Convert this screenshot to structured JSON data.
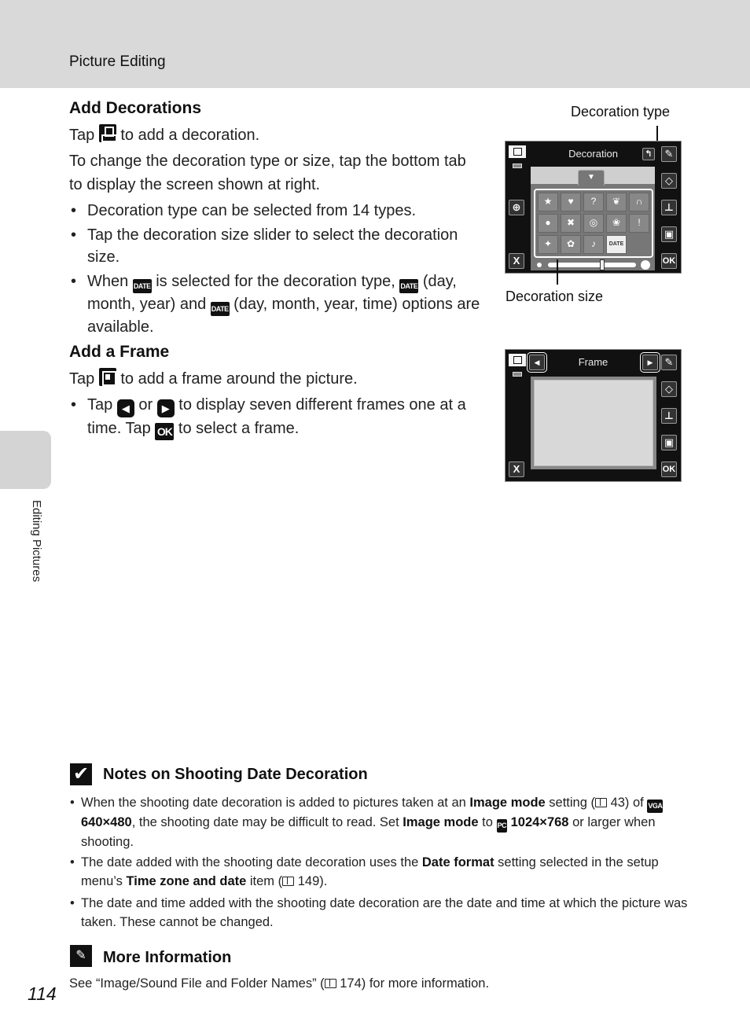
{
  "header": {
    "title": "Picture Editing"
  },
  "side_tab": {
    "label": "Editing Pictures"
  },
  "page_number": "114",
  "sections": {
    "decorations": {
      "heading": "Add Decorations",
      "tap_pre": "Tap",
      "tap_post": "to add a decoration.",
      "intro": "To change the decoration type or size, tap the bottom tab to display the screen shown at right.",
      "bullet1": "Decoration type can be selected from 14 types.",
      "bullet2": "Tap the decoration size slider to select the decoration size.",
      "bullet3_a": "When",
      "bullet3_b": "is selected for the decoration type,",
      "bullet3_c": "(day, month, year) and",
      "bullet3_d": "(day, month, year, time) options are available.",
      "date_icon": "DATE"
    },
    "frame": {
      "heading": "Add a Frame",
      "tap_pre": "Tap",
      "tap_post": "to add a frame around the picture.",
      "bullet_a": "Tap",
      "bullet_b": "or",
      "bullet_c": "to display seven different frames one at a time. Tap",
      "bullet_d": "to select a frame.",
      "ok_icon": "OK",
      "left_arrow": "◀",
      "right_arrow": "▶"
    }
  },
  "screens": {
    "decoration": {
      "title": "Decoration",
      "callout_type": "Decoration type",
      "callout_size": "Decoration size",
      "grid": [
        "★",
        "♥",
        "?",
        "❦",
        "∩",
        "●",
        "✖",
        "◎",
        "❀",
        "!",
        "✦",
        "✿",
        "♪",
        "DATE",
        ""
      ],
      "close": "X",
      "ok": "OK",
      "back": "↰",
      "size_slider_position": 0.62
    },
    "frame": {
      "title": "Frame",
      "close": "X",
      "ok": "OK",
      "prev": "◀",
      "next": "▶"
    },
    "side_tools": [
      "pencil",
      "eraser",
      "stamp",
      "frame"
    ]
  },
  "notes": {
    "icon": "✔",
    "heading": "Notes on Shooting Date Decoration",
    "b1_1": "When the shooting date decoration is added to pictures taken at an ",
    "b1_2": "Image mode",
    "b1_3": " setting (",
    "b1_4": " 43) of ",
    "b1_vga": "VGA",
    "b1_5": " 640×480",
    "b1_6": ", the shooting date may be difficult to read. Set ",
    "b1_7": "Image mode",
    "b1_8": " to ",
    "b1_pc": "PC",
    "b1_9": " 1024×768",
    "b1_10": " or larger when shooting.",
    "b2_1": "The date added with the shooting date decoration uses the ",
    "b2_2": "Date format",
    "b2_3": " setting selected in the setup menu’s ",
    "b2_4": "Time zone and date",
    "b2_5": " item (",
    "b2_6": " 149).",
    "b3": "The date and time added with the shooting date decoration are the date and time at which the picture was taken. These cannot be changed."
  },
  "more_info": {
    "heading": "More Information",
    "text_1": "See “Image/Sound File and Folder Names” (",
    "text_2": " 174) for more information."
  }
}
